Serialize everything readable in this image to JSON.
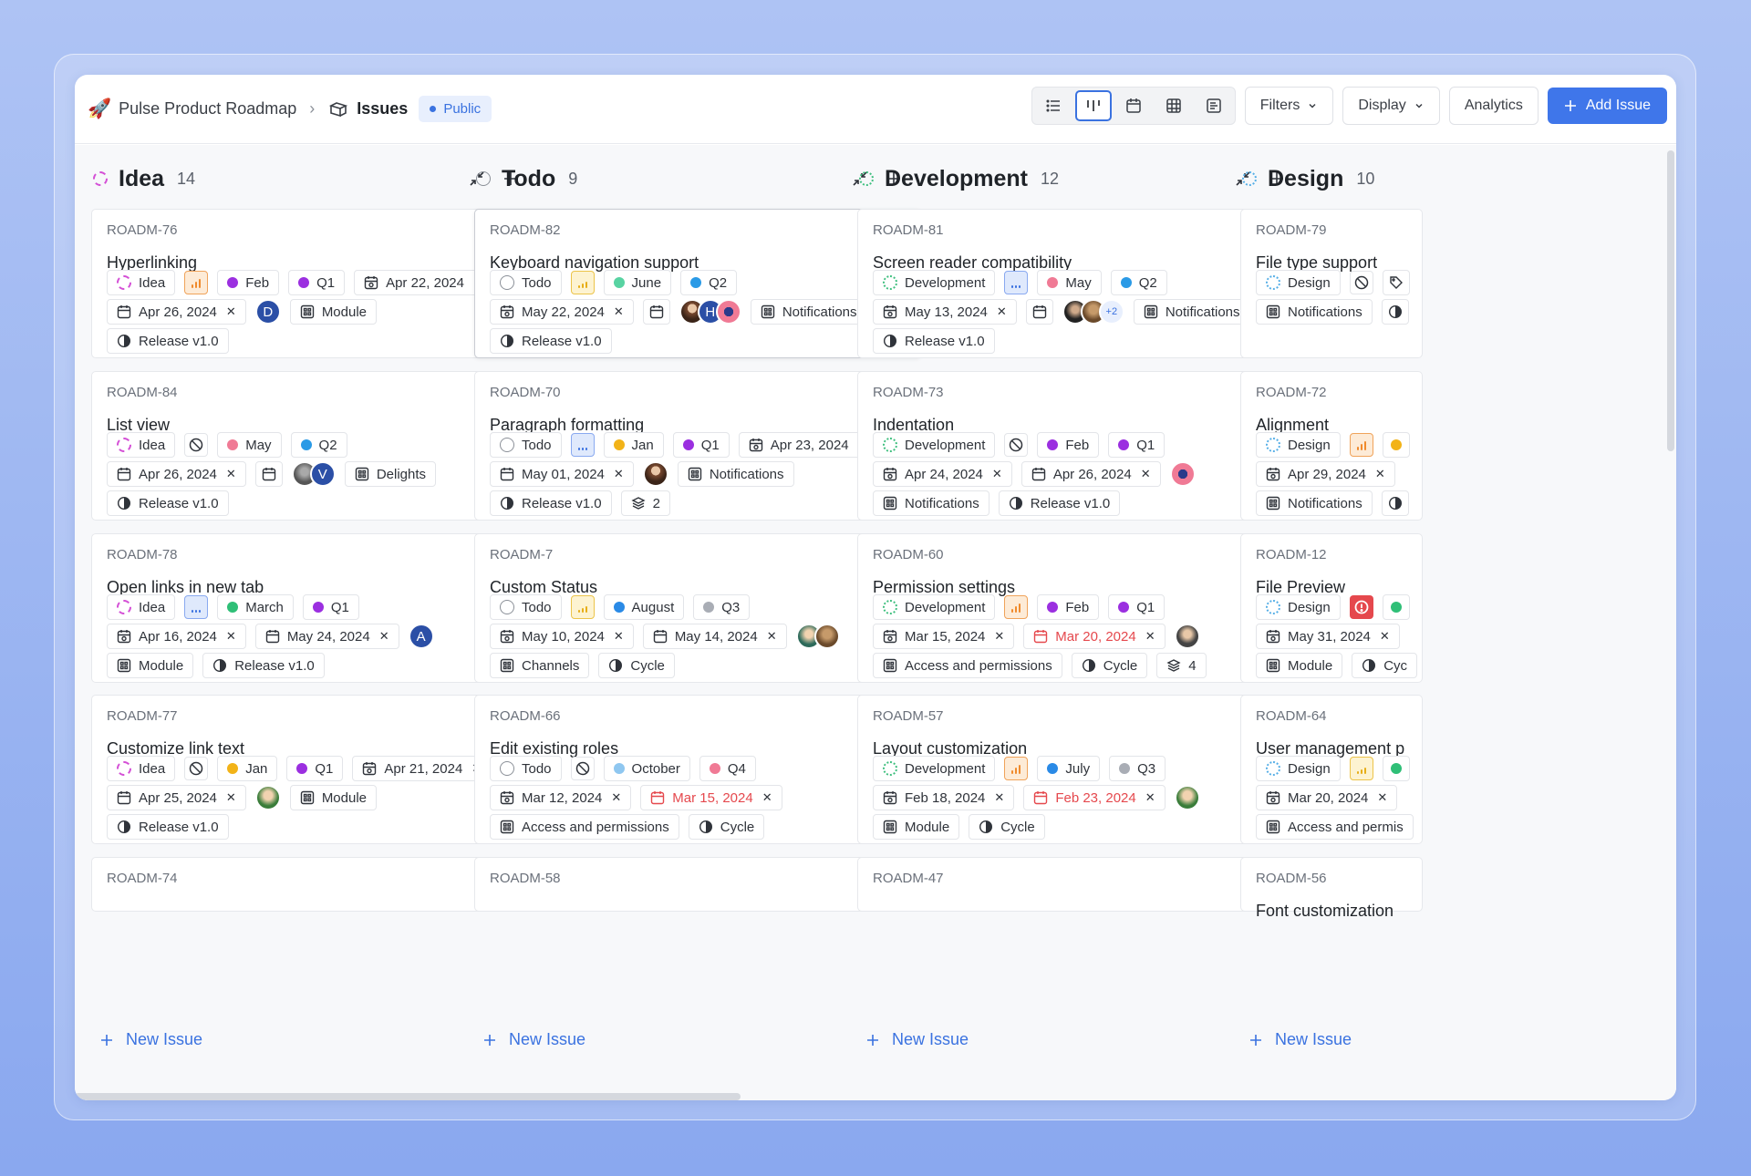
{
  "project": {
    "emoji": "🚀",
    "name": "Pulse Product Roadmap"
  },
  "breadcrumb": {
    "page": "Issues",
    "visibility": "Public"
  },
  "toolbar": {
    "filters": "Filters",
    "display": "Display",
    "analytics": "Analytics",
    "add_issue": "Add Issue"
  },
  "colors": {
    "accent": "#3f76ea",
    "idea": "#d44fd6",
    "development": "#3fbf7f",
    "design": "#55aee6",
    "urgent": "#e5484d"
  },
  "new_issue_label": "New Issue",
  "columns": [
    {
      "title": "Idea",
      "count": "14",
      "cards": [
        {
          "id": "ROADM-76",
          "title": "Hyperlinking",
          "rows": [
            [
              {
                "t": "Idea"
              },
              {
                "t": "Feb"
              },
              {
                "t": "Q1"
              },
              {
                "t": "Apr 22, 2024"
              }
            ],
            [
              {
                "t": "Apr 26, 2024"
              },
              {
                "t": "D"
              },
              {
                "t": "Module"
              }
            ],
            [
              {
                "t": "Release v1.0"
              }
            ]
          ]
        },
        {
          "id": "ROADM-84",
          "title": "List view",
          "rows": [
            [
              {
                "t": "Idea"
              },
              {
                "t": "May"
              },
              {
                "t": "Q2"
              }
            ],
            [
              {
                "t": "Apr 26, 2024"
              },
              {
                "t": "V"
              },
              {
                "t": "Delights"
              }
            ],
            [
              {
                "t": "Release v1.0"
              }
            ]
          ]
        },
        {
          "id": "ROADM-78",
          "title": "Open links in new tab",
          "rows": [
            [
              {
                "t": "Idea"
              },
              {
                "t": "March"
              },
              {
                "t": "Q1"
              }
            ],
            [
              {
                "t": "Apr 16, 2024"
              },
              {
                "t": "May 24, 2024"
              },
              {
                "t": "A"
              }
            ],
            [
              {
                "t": "Module"
              },
              {
                "t": "Release v1.0"
              }
            ]
          ]
        },
        {
          "id": "ROADM-77",
          "title": "Customize link text",
          "rows": [
            [
              {
                "t": "Idea"
              },
              {
                "t": "Jan"
              },
              {
                "t": "Q1"
              },
              {
                "t": "Apr 21, 2024"
              }
            ],
            [
              {
                "t": "Apr 25, 2024"
              },
              {
                "t": "Module"
              }
            ],
            [
              {
                "t": "Release v1.0"
              }
            ]
          ]
        },
        {
          "id": "ROADM-74"
        }
      ]
    },
    {
      "title": "Todo",
      "count": "9",
      "cards": [
        {
          "id": "ROADM-82",
          "title": "Keyboard navigation support",
          "rows": [
            [
              {
                "t": "Todo"
              },
              {
                "t": "June"
              },
              {
                "t": "Q2"
              }
            ],
            [
              {
                "t": "May 22, 2024"
              },
              {
                "t": "H"
              },
              {
                "t": "Notifications"
              }
            ],
            [
              {
                "t": "Release v1.0"
              }
            ]
          ]
        },
        {
          "id": "ROADM-70",
          "title": "Paragraph formatting",
          "rows": [
            [
              {
                "t": "Todo"
              },
              {
                "t": "Jan"
              },
              {
                "t": "Q1"
              },
              {
                "t": "Apr 23, 2024"
              }
            ],
            [
              {
                "t": "May 01, 2024"
              },
              {
                "t": "Notifications"
              }
            ],
            [
              {
                "t": "Release v1.0"
              },
              {
                "t": "2"
              }
            ]
          ]
        },
        {
          "id": "ROADM-7",
          "title": "Custom Status",
          "rows": [
            [
              {
                "t": "Todo"
              },
              {
                "t": "August"
              },
              {
                "t": "Q3"
              }
            ],
            [
              {
                "t": "May 10, 2024"
              },
              {
                "t": "May 14, 2024"
              }
            ],
            [
              {
                "t": "Channels"
              },
              {
                "t": "Cycle"
              }
            ]
          ]
        },
        {
          "id": "ROADM-66",
          "title": "Edit existing roles",
          "rows": [
            [
              {
                "t": "Todo"
              },
              {
                "t": "October"
              },
              {
                "t": "Q4"
              }
            ],
            [
              {
                "t": "Mar 12, 2024"
              },
              {
                "t": "Mar 15, 2024"
              }
            ],
            [
              {
                "t": "Access and permissions"
              },
              {
                "t": "Cycle"
              }
            ]
          ]
        },
        {
          "id": "ROADM-58"
        }
      ]
    },
    {
      "title": "Development",
      "count": "12",
      "cards": [
        {
          "id": "ROADM-81",
          "title": "Screen reader compatibility",
          "rows": [
            [
              {
                "t": "Development"
              },
              {
                "t": "May"
              },
              {
                "t": "Q2"
              }
            ],
            [
              {
                "t": "May 13, 2024"
              },
              {
                "t": "+2"
              },
              {
                "t": "Notifications"
              }
            ],
            [
              {
                "t": "Release v1.0"
              }
            ]
          ]
        },
        {
          "id": "ROADM-73",
          "title": "Indentation",
          "rows": [
            [
              {
                "t": "Development"
              },
              {
                "t": "Feb"
              },
              {
                "t": "Q1"
              }
            ],
            [
              {
                "t": "Apr 24, 2024"
              },
              {
                "t": "Apr 26, 2024"
              }
            ],
            [
              {
                "t": "Notifications"
              },
              {
                "t": "Release v1.0"
              }
            ]
          ]
        },
        {
          "id": "ROADM-60",
          "title": "Permission settings",
          "rows": [
            [
              {
                "t": "Development"
              },
              {
                "t": "Feb"
              },
              {
                "t": "Q1"
              }
            ],
            [
              {
                "t": "Mar 15, 2024"
              },
              {
                "t": "Mar 20, 2024"
              }
            ],
            [
              {
                "t": "Access and permissions"
              },
              {
                "t": "Cycle"
              },
              {
                "t": "4"
              }
            ]
          ]
        },
        {
          "id": "ROADM-57",
          "title": "Layout customization",
          "rows": [
            [
              {
                "t": "Development"
              },
              {
                "t": "July"
              },
              {
                "t": "Q3"
              }
            ],
            [
              {
                "t": "Feb 18, 2024"
              },
              {
                "t": "Feb 23, 2024"
              }
            ],
            [
              {
                "t": "Module"
              },
              {
                "t": "Cycle"
              }
            ]
          ]
        },
        {
          "id": "ROADM-47"
        }
      ]
    },
    {
      "title": "Design",
      "count": "10",
      "cards": [
        {
          "id": "ROADM-79",
          "title": "File type support",
          "rows": [
            [
              {
                "t": "Design"
              }
            ],
            [
              {
                "t": "Notifications"
              }
            ]
          ]
        },
        {
          "id": "ROADM-72",
          "title": "Alignment",
          "rows": [
            [
              {
                "t": "Design"
              }
            ],
            [
              {
                "t": "Apr 29, 2024"
              }
            ],
            [
              {
                "t": "Notifications"
              }
            ]
          ]
        },
        {
          "id": "ROADM-12",
          "title": "File Preview",
          "rows": [
            [
              {
                "t": "Design"
              }
            ],
            [
              {
                "t": "May 31, 2024"
              }
            ],
            [
              {
                "t": "Module"
              },
              {
                "t": "Cyc"
              }
            ]
          ]
        },
        {
          "id": "ROADM-64",
          "title": "User management p",
          "rows": [
            [
              {
                "t": "Design"
              }
            ],
            [
              {
                "t": "Mar 20, 2024"
              }
            ],
            [
              {
                "t": "Access and permis"
              }
            ]
          ]
        },
        {
          "id": "ROADM-56",
          "title": "Font customization"
        }
      ]
    }
  ]
}
